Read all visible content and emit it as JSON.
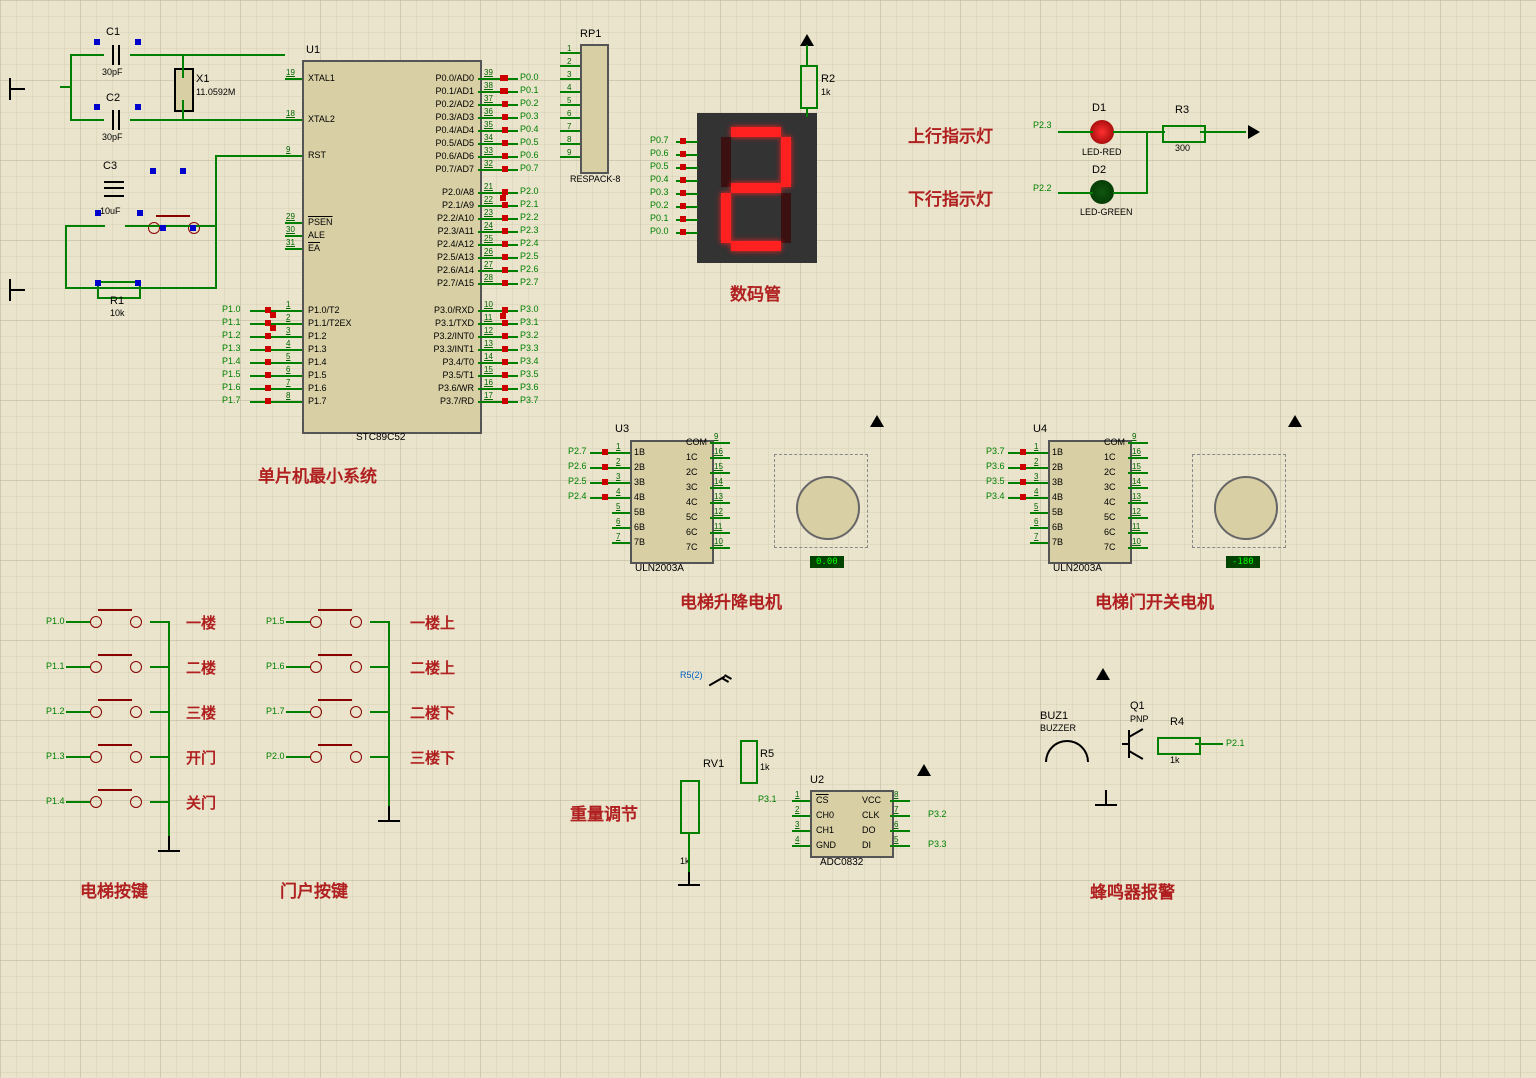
{
  "components": {
    "c1": {
      "ref": "C1",
      "value": "30pF"
    },
    "c2": {
      "ref": "C2",
      "value": "30pF"
    },
    "c3": {
      "ref": "C3",
      "value": "10uF"
    },
    "x1": {
      "ref": "X1",
      "value": "11.0592M"
    },
    "r1": {
      "ref": "R1",
      "value": "10k"
    },
    "r2": {
      "ref": "R2",
      "value": "1k"
    },
    "r3": {
      "ref": "R3",
      "value": "300"
    },
    "r4": {
      "ref": "R4",
      "value": "1k"
    },
    "r5": {
      "ref": "R5",
      "value": "1k"
    },
    "rv1": {
      "ref": "RV1",
      "value": "1k"
    },
    "rp1": {
      "ref": "RP1",
      "value": "RESPACK-8"
    },
    "u1": {
      "ref": "U1",
      "model": "STC89C52"
    },
    "u2": {
      "ref": "U2",
      "model": "ADC0832"
    },
    "u3": {
      "ref": "U3",
      "model": "ULN2003A"
    },
    "u4": {
      "ref": "U4",
      "model": "ULN2003A"
    },
    "d1": {
      "ref": "D1",
      "model": "LED-RED"
    },
    "d2": {
      "ref": "D2",
      "model": "LED-GREEN"
    },
    "buz1": {
      "ref": "BUZ1",
      "model": "BUZZER"
    },
    "q1": {
      "ref": "Q1",
      "model": "PNP"
    }
  },
  "section_labels": {
    "mcu_system": "单片机最小系统",
    "seven_seg": "数码管",
    "up_led": "上行指示灯",
    "down_led": "下行指示灯",
    "lift_motor": "电梯升降电机",
    "door_motor": "电梯门开关电机",
    "weight_adj": "重量调节",
    "buzzer_alarm": "蜂鸣器报警",
    "elev_buttons": "电梯按键",
    "floor_buttons": "门户按键"
  },
  "probe_label": "R5(2)",
  "elevator_buttons": [
    "一楼",
    "二楼",
    "三楼",
    "开门",
    "关门"
  ],
  "floor_buttons": [
    "一楼上",
    "二楼上",
    "二楼下",
    "三楼下"
  ],
  "elevator_nets": [
    "P1.0",
    "P1.1",
    "P1.2",
    "P1.3",
    "P1.4"
  ],
  "floor_nets": [
    "P1.5",
    "P1.6",
    "P1.7",
    "P2.0"
  ],
  "motor_reading_u3": "0.00",
  "motor_reading_u4": "-180",
  "led_net_up": "P2.3",
  "led_net_down": "P2.2",
  "buzzer_net": "P2.1",
  "u1_left_pins": [
    {
      "n": "19",
      "t": "XTAL1"
    },
    {
      "n": "18",
      "t": "XTAL2"
    },
    {
      "n": "9",
      "t": "RST"
    },
    {
      "n": "29",
      "t": "PSEN",
      "bar": true
    },
    {
      "n": "30",
      "t": "ALE"
    },
    {
      "n": "31",
      "t": "EA",
      "bar": true
    },
    {
      "n": "1",
      "t": "P1.0/T2"
    },
    {
      "n": "2",
      "t": "P1.1/T2EX"
    },
    {
      "n": "3",
      "t": "P1.2"
    },
    {
      "n": "4",
      "t": "P1.3"
    },
    {
      "n": "5",
      "t": "P1.4"
    },
    {
      "n": "6",
      "t": "P1.5"
    },
    {
      "n": "7",
      "t": "P1.6"
    },
    {
      "n": "8",
      "t": "P1.7"
    }
  ],
  "u1_right_top": [
    {
      "n": "39",
      "t": "P0.0/AD0"
    },
    {
      "n": "38",
      "t": "P0.1/AD1"
    },
    {
      "n": "37",
      "t": "P0.2/AD2"
    },
    {
      "n": "36",
      "t": "P0.3/AD3"
    },
    {
      "n": "35",
      "t": "P0.4/AD4"
    },
    {
      "n": "34",
      "t": "P0.5/AD5"
    },
    {
      "n": "33",
      "t": "P0.6/AD6"
    },
    {
      "n": "32",
      "t": "P0.7/AD7"
    }
  ],
  "u1_right_mid": [
    {
      "n": "21",
      "t": "P2.0/A8"
    },
    {
      "n": "22",
      "t": "P2.1/A9"
    },
    {
      "n": "23",
      "t": "P2.2/A10"
    },
    {
      "n": "24",
      "t": "P2.3/A11"
    },
    {
      "n": "25",
      "t": "P2.4/A12"
    },
    {
      "n": "26",
      "t": "P2.5/A13"
    },
    {
      "n": "27",
      "t": "P2.6/A14"
    },
    {
      "n": "28",
      "t": "P2.7/A15"
    }
  ],
  "u1_right_bot": [
    {
      "n": "10",
      "t": "P3.0/RXD"
    },
    {
      "n": "11",
      "t": "P3.1/TXD"
    },
    {
      "n": "12",
      "t": "P3.2/INT0",
      "bar": "INT0"
    },
    {
      "n": "13",
      "t": "P3.3/INT1",
      "bar": "INT1"
    },
    {
      "n": "14",
      "t": "P3.4/T0"
    },
    {
      "n": "15",
      "t": "P3.5/T1"
    },
    {
      "n": "16",
      "t": "P3.6/WR",
      "bar": "WR"
    },
    {
      "n": "17",
      "t": "P3.7/RD",
      "bar": "RD"
    }
  ],
  "p0_nets": [
    "P0.0",
    "P0.1",
    "P0.2",
    "P0.3",
    "P0.4",
    "P0.5",
    "P0.6",
    "P0.7"
  ],
  "p1_bus_nets": [
    "P1.0",
    "P1.1",
    "P1.2",
    "P1.3",
    "P1.4",
    "P1.5",
    "P1.6",
    "P1.7"
  ],
  "p2_nets": [
    "P2.0",
    "P2.1",
    "P2.2",
    "P2.3",
    "P2.4",
    "P2.5",
    "P2.6",
    "P2.7"
  ],
  "p3_nets": [
    "P3.0",
    "P3.1",
    "P3.2",
    "P3.3",
    "P3.4",
    "P3.5",
    "P3.6",
    "P3.7"
  ],
  "seg_nets": [
    "P0.7",
    "P0.6",
    "P0.5",
    "P0.4",
    "P0.3",
    "P0.2",
    "P0.1",
    "P0.0"
  ],
  "uln_left_pins": [
    {
      "n": "1",
      "t": "1B"
    },
    {
      "n": "2",
      "t": "2B"
    },
    {
      "n": "3",
      "t": "3B"
    },
    {
      "n": "4",
      "t": "4B"
    },
    {
      "n": "5",
      "t": "5B"
    },
    {
      "n": "6",
      "t": "6B"
    },
    {
      "n": "7",
      "t": "7B"
    }
  ],
  "uln_right_pins": [
    {
      "n": "9",
      "t": "COM"
    },
    {
      "n": "16",
      "t": "1C"
    },
    {
      "n": "15",
      "t": "2C"
    },
    {
      "n": "14",
      "t": "3C"
    },
    {
      "n": "13",
      "t": "4C"
    },
    {
      "n": "12",
      "t": "5C"
    },
    {
      "n": "11",
      "t": "6C"
    },
    {
      "n": "10",
      "t": "7C"
    }
  ],
  "u3_input_nets": [
    "P2.7",
    "P2.6",
    "P2.5",
    "P2.4"
  ],
  "u4_input_nets": [
    "P3.7",
    "P3.6",
    "P3.5",
    "P3.4"
  ],
  "adc_left": [
    {
      "n": "1",
      "t": "CS",
      "bar": true
    },
    {
      "n": "2",
      "t": "CH0"
    },
    {
      "n": "3",
      "t": "CH1"
    },
    {
      "n": "4",
      "t": "GND"
    }
  ],
  "adc_right": [
    {
      "n": "8",
      "t": "VCC"
    },
    {
      "n": "7",
      "t": "CLK"
    },
    {
      "n": "6",
      "t": "DO"
    },
    {
      "n": "5",
      "t": "DI"
    }
  ],
  "adc_nets": {
    "cs": "P3.1",
    "clk": "P3.2",
    "do": "P3.3"
  },
  "rp1_pins": [
    "1",
    "2",
    "3",
    "4",
    "5",
    "6",
    "7",
    "8",
    "9"
  ]
}
